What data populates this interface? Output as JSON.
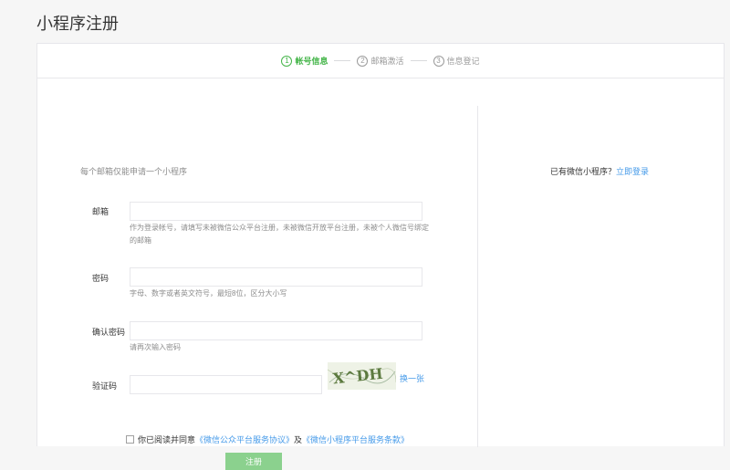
{
  "page": {
    "title": "小程序注册"
  },
  "steps": [
    {
      "num": "1",
      "label": "帐号信息",
      "active": true
    },
    {
      "num": "2",
      "label": "邮箱激活",
      "active": false
    },
    {
      "num": "3",
      "label": "信息登记",
      "active": false
    }
  ],
  "form": {
    "intro": "每个邮箱仅能申请一个小程序",
    "email": {
      "label": "邮箱",
      "value": "",
      "placeholder": "",
      "tip": "作为登录帐号，请填写未被微信公众平台注册，未被微信开放平台注册，未被个人微信号绑定的邮箱"
    },
    "password": {
      "label": "密码",
      "value": "",
      "placeholder": "",
      "tip": "字母、数字或者英文符号，最短8位，区分大小写"
    },
    "confirm": {
      "label": "确认密码",
      "value": "",
      "placeholder": "",
      "tip": "请再次输入密码"
    },
    "captcha": {
      "label": "验证码",
      "value": "",
      "placeholder": "",
      "image_text": "X^DH",
      "refresh_label": "换一张"
    },
    "agreement": {
      "prefix": "你已阅读并同意",
      "link1": "《微信公众平台服务协议》",
      "joiner": "及",
      "link2": "《微信小程序平台服务条款》",
      "checked": false
    },
    "submit_label": "注册"
  },
  "side": {
    "text": "已有微信小程序？",
    "login_link": "立即登录"
  },
  "colors": {
    "accent": "#44b549",
    "link": "#459ae9",
    "button_disabled": "#8bd18e"
  }
}
